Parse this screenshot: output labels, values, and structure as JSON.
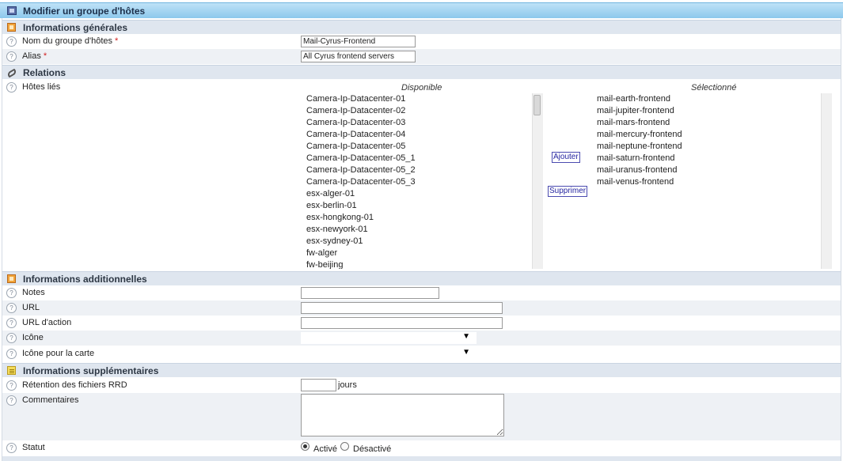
{
  "header": {
    "title": "Modifier un groupe d'hôtes",
    "icon": "hostgroup-icon"
  },
  "sections": {
    "general": "Informations générales",
    "relations": "Relations",
    "additional": "Informations additionnelles",
    "extra": "Informations supplémentaires"
  },
  "help_glyph": "?",
  "required_mark": "*",
  "general": {
    "name_label": "Nom du groupe d'hôtes",
    "name_value": "Mail-Cyrus-Frontend",
    "alias_label": "Alias",
    "alias_value": "All Cyrus frontend servers"
  },
  "relations": {
    "linked_hosts_label": "Hôtes liés",
    "available_header": "Disponible",
    "selected_header": "Sélectionné",
    "add_label": "Ajouter",
    "remove_label": "Supprimer",
    "available": [
      "Camera-Ip-Datacenter-01",
      "Camera-Ip-Datacenter-02",
      "Camera-Ip-Datacenter-03",
      "Camera-Ip-Datacenter-04",
      "Camera-Ip-Datacenter-05",
      "Camera-Ip-Datacenter-05_1",
      "Camera-Ip-Datacenter-05_2",
      "Camera-Ip-Datacenter-05_3",
      "esx-alger-01",
      "esx-berlin-01",
      "esx-hongkong-01",
      "esx-newyork-01",
      "esx-sydney-01",
      "fw-alger",
      "fw-beijing"
    ],
    "selected": [
      "mail-earth-frontend",
      "mail-jupiter-frontend",
      "mail-mars-frontend",
      "mail-mercury-frontend",
      "mail-neptune-frontend",
      "mail-saturn-frontend",
      "mail-uranus-frontend",
      "mail-venus-frontend"
    ]
  },
  "additional": {
    "notes_label": "Notes",
    "notes_value": "",
    "url_label": "URL",
    "url_value": "",
    "action_url_label": "URL d'action",
    "action_url_value": "",
    "icon_label": "Icône",
    "icon_value": "",
    "map_icon_label": "Icône pour la carte",
    "map_icon_value": "",
    "dropdown_arrow": "▼"
  },
  "extra": {
    "rrd_label": "Rétention des fichiers RRD",
    "rrd_value": "",
    "rrd_unit": "jours",
    "comments_label": "Commentaires",
    "comments_value": "",
    "status_label": "Statut",
    "status_active": "Activé",
    "status_inactive": "Désactivé",
    "status_selected": "active"
  }
}
